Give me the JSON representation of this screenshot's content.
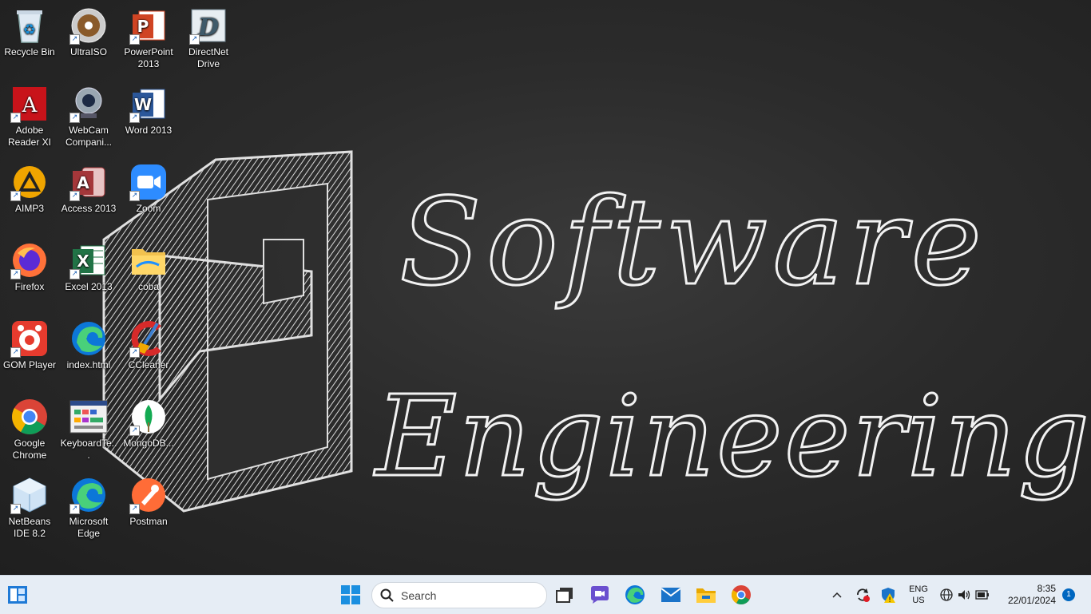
{
  "wallpaper": {
    "line1": "Software",
    "line2": "Engineering"
  },
  "desktop_icons": [
    {
      "label": "Recycle Bin",
      "icon": "recycle-bin-icon"
    },
    {
      "label": "UltraISO",
      "icon": "ultraiso-icon"
    },
    {
      "label": "PowerPoint 2013",
      "icon": "powerpoint-icon"
    },
    {
      "label": "DirectNet Drive",
      "icon": "directnet-drive-icon"
    },
    {
      "label": "Adobe Reader XI",
      "icon": "adobe-reader-icon"
    },
    {
      "label": "WebCam Compani...",
      "icon": "webcam-icon"
    },
    {
      "label": "Word 2013",
      "icon": "word-icon"
    },
    {
      "label": "AIMP3",
      "icon": "aimp-icon"
    },
    {
      "label": "Access 2013",
      "icon": "access-icon"
    },
    {
      "label": "Zoom",
      "icon": "zoom-icon"
    },
    {
      "label": "Firefox",
      "icon": "firefox-icon"
    },
    {
      "label": "Excel 2013",
      "icon": "excel-icon"
    },
    {
      "label": "coba",
      "icon": "folder-icon"
    },
    {
      "label": "GOM Player",
      "icon": "gom-player-icon"
    },
    {
      "label": "index.html",
      "icon": "edge-html-icon"
    },
    {
      "label": "CCleaner",
      "icon": "ccleaner-icon"
    },
    {
      "label": "Google Chrome",
      "icon": "chrome-icon"
    },
    {
      "label": "KeyboardTe...",
      "icon": "keyboard-test-icon"
    },
    {
      "label": "MongoDB...",
      "icon": "mongodb-icon"
    },
    {
      "label": "NetBeans IDE 8.2",
      "icon": "netbeans-icon"
    },
    {
      "label": "Microsoft Edge",
      "icon": "edge-icon"
    },
    {
      "label": "Postman",
      "icon": "postman-icon"
    }
  ],
  "taskbar": {
    "search_placeholder": "Search",
    "language": "ENG",
    "region": "US",
    "time": "8:35",
    "date": "22/01/2024",
    "notification_count": "1"
  }
}
